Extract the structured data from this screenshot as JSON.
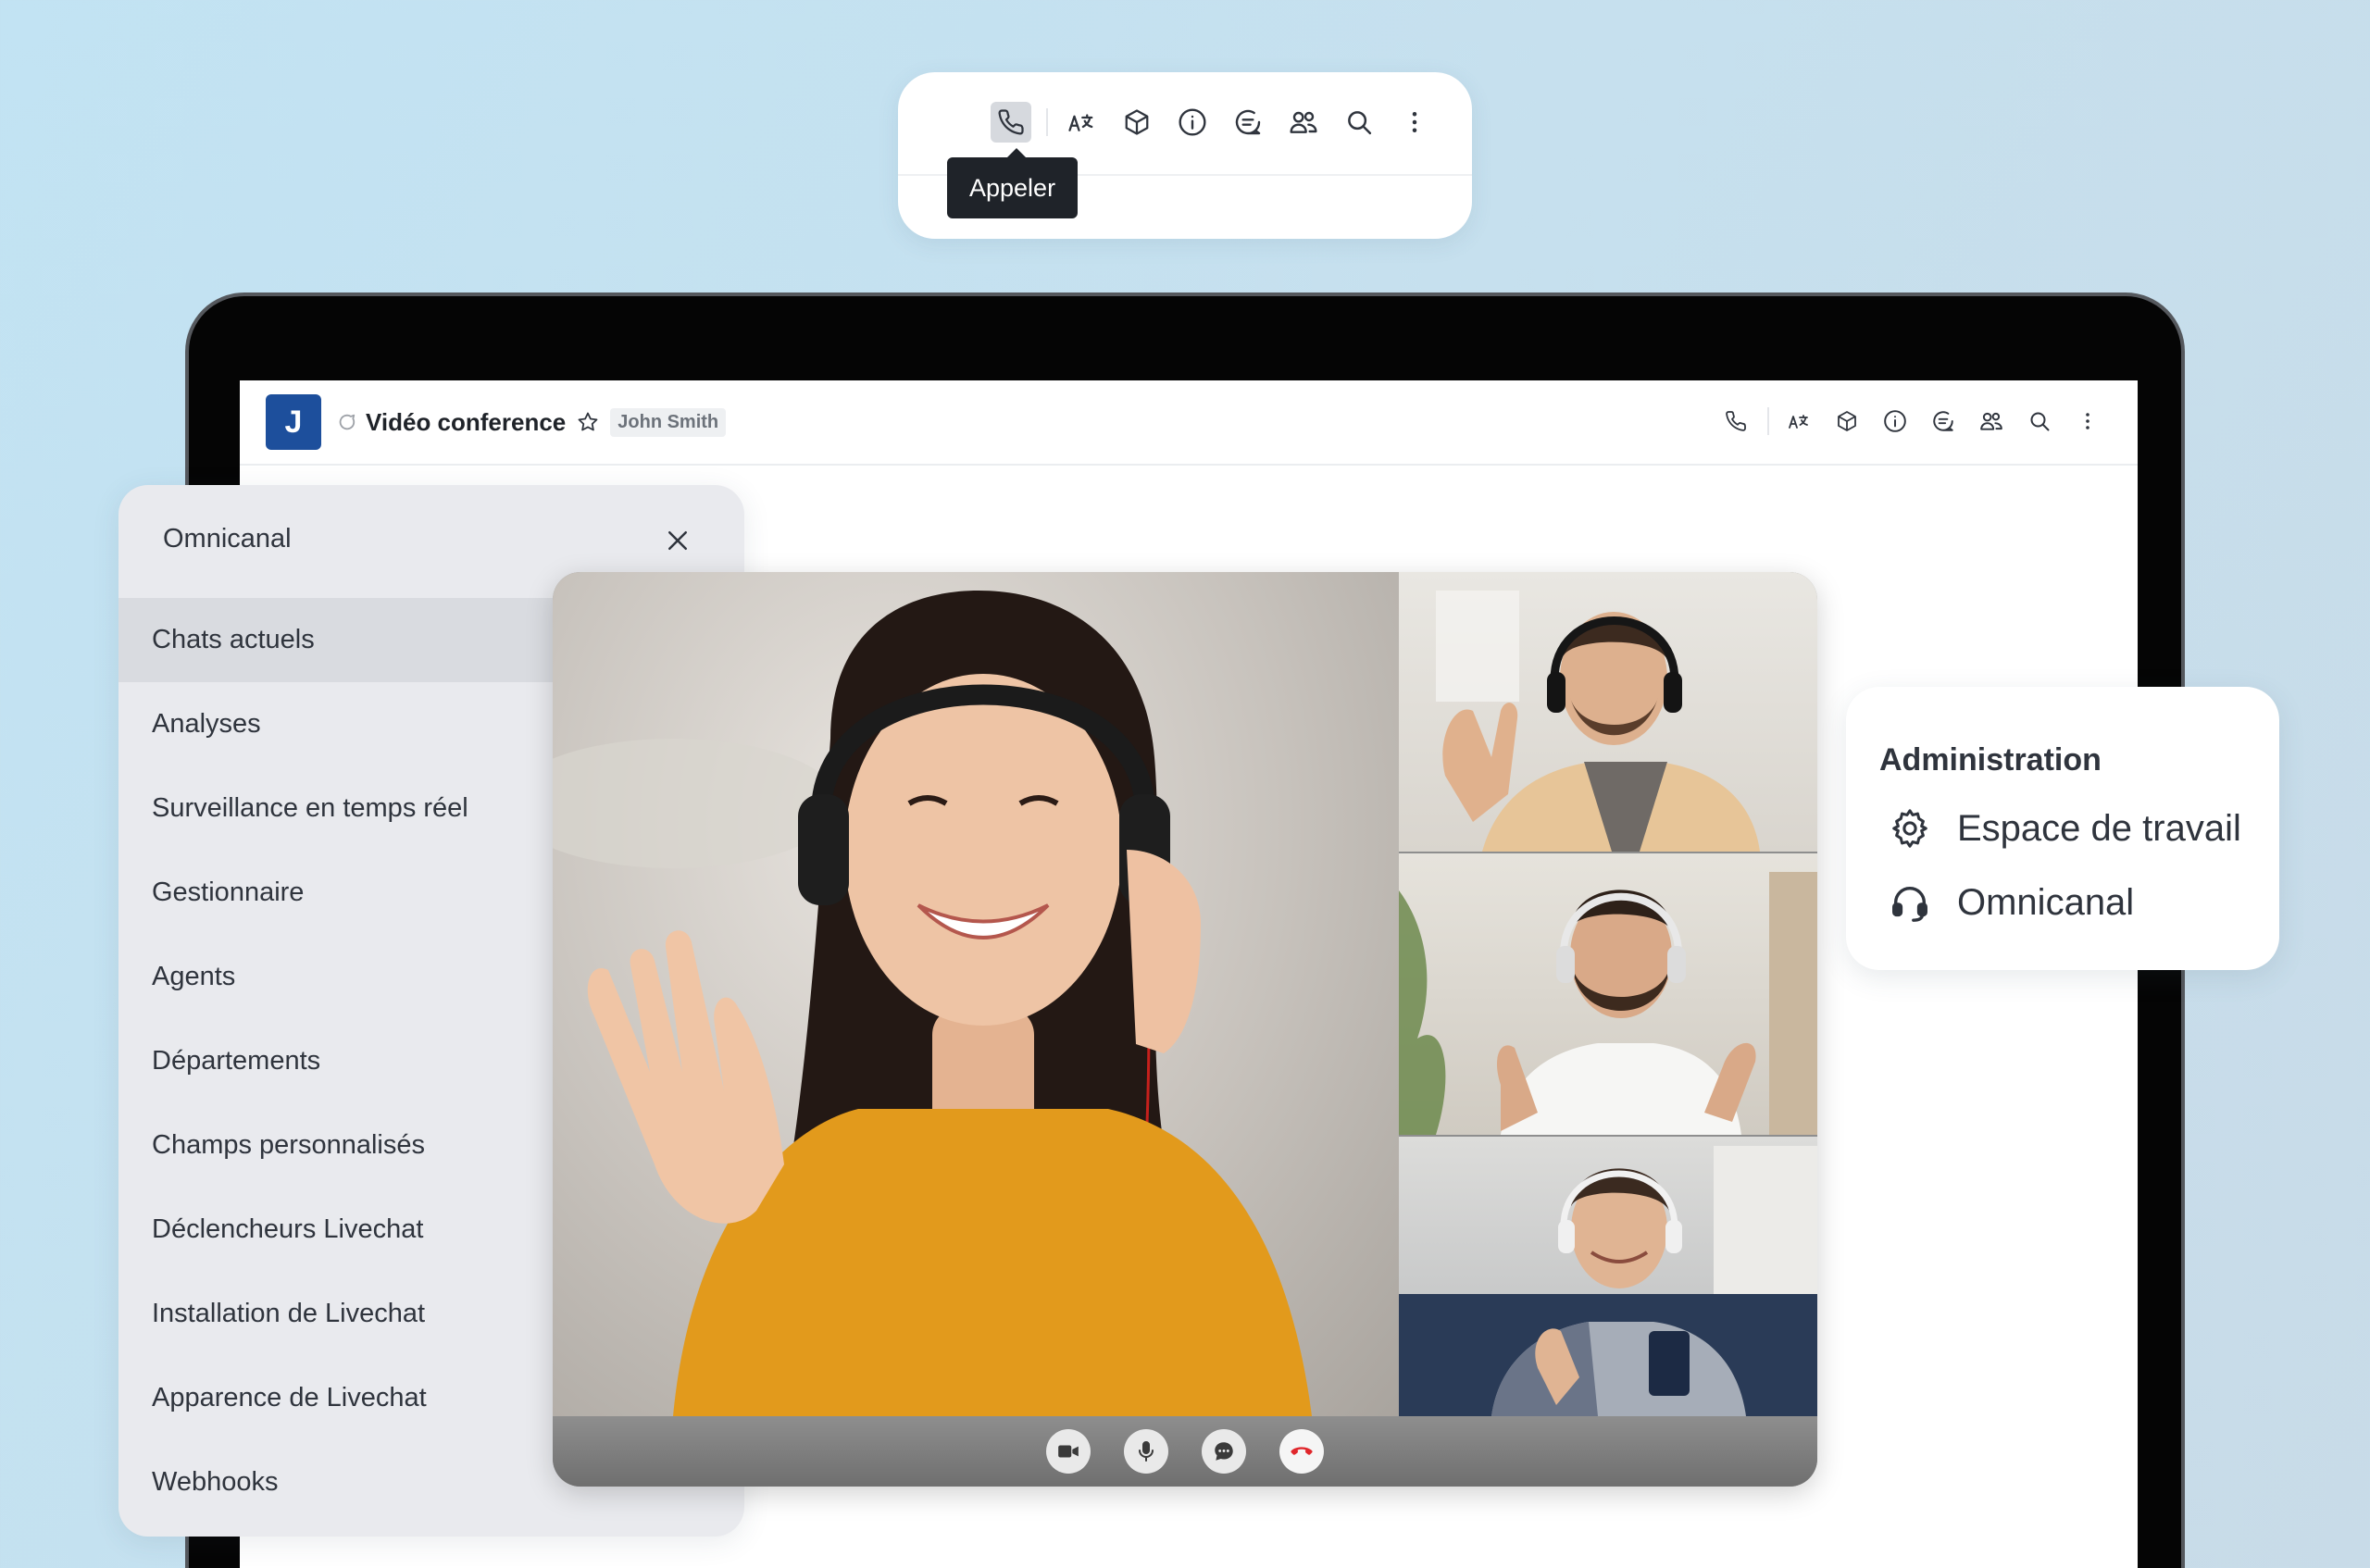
{
  "floating_toolbar": {
    "tooltip": "Appeler",
    "icons": [
      "phone-icon",
      "translate-icon",
      "cube-icon",
      "info-icon",
      "discussion-icon",
      "members-icon",
      "search-icon",
      "kebab-icon"
    ]
  },
  "room": {
    "avatar_letter": "J",
    "title": "Vidéo conference",
    "tag": "John Smith",
    "header_icons": [
      "phone-icon",
      "translate-icon",
      "cube-icon",
      "info-icon",
      "discussion-icon",
      "members-icon",
      "search-icon",
      "kebab-icon"
    ]
  },
  "omnichannel_panel": {
    "title": "Omnicanal",
    "items": [
      {
        "label": "Chats actuels",
        "active": true
      },
      {
        "label": "Analyses"
      },
      {
        "label": "Surveillance en temps réel"
      },
      {
        "label": "Gestionnaire"
      },
      {
        "label": "Agents"
      },
      {
        "label": "Départements"
      },
      {
        "label": "Champs personnalisés"
      },
      {
        "label": "Déclencheurs Livechat"
      },
      {
        "label": "Installation de Livechat"
      },
      {
        "label": "Apparence de Livechat"
      },
      {
        "label": "Webhooks"
      }
    ]
  },
  "video_call": {
    "controls": [
      "video-camera-icon",
      "microphone-icon",
      "chat-bubble-icon",
      "hang-up-icon"
    ],
    "colors": {
      "hang_up": "#e0262b"
    }
  },
  "administration": {
    "title": "Administration",
    "items": [
      {
        "label": "Espace de travail",
        "icon": "gear-icon"
      },
      {
        "label": "Omnicanal",
        "icon": "headset-icon"
      }
    ]
  },
  "colors": {
    "avatar": "#1d4f9c",
    "background": "#c4e1f0",
    "tooltip": "#1f2329"
  }
}
